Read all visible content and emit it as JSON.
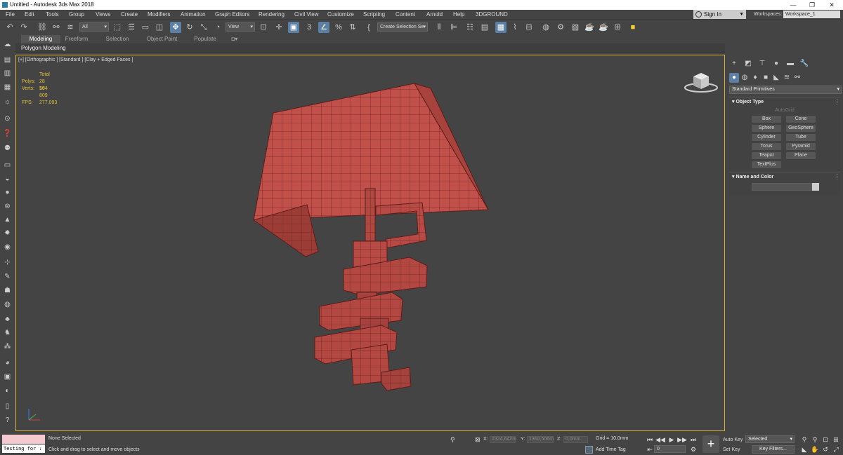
{
  "window": {
    "title": "Untitled - Autodesk 3ds Max 2018",
    "min": "—",
    "restore": "❐",
    "close": "✕"
  },
  "menu": [
    "File",
    "Edit",
    "Tools",
    "Group",
    "Views",
    "Create",
    "Modifiers",
    "Animation",
    "Graph Editors",
    "Rendering",
    "Civil View",
    "Customize",
    "Scripting",
    "Content",
    "Arnold",
    "Help",
    "3DGROUND"
  ],
  "account": {
    "sign_in": "Sign In",
    "workspaces_label": "Workspaces:",
    "workspace": "Workspace_1"
  },
  "toolbar": {
    "selection_filter": "All",
    "ref_coord": "View",
    "named_selection": "Create Selection Se"
  },
  "ribbon": {
    "tabs": [
      "Modeling",
      "Freeform",
      "Selection",
      "Object Paint",
      "Populate"
    ],
    "active": "Modeling",
    "subtitle": "Polygon Modeling"
  },
  "viewport": {
    "label": "[+] [Orthographic ] [Standard ] [Clay + Edged Faces ]",
    "stats": {
      "header": "Total",
      "polys_label": "Polys:",
      "polys": "28 594",
      "verts_label": "Verts:",
      "verts": "16 809",
      "fps_label": "FPS:",
      "fps": "277,093"
    },
    "mesh_color": "#c0504a",
    "highlight_color": "#d8b23a"
  },
  "command_panel": {
    "category": "Standard Primitives",
    "object_type": {
      "title": "Object Type",
      "autogrid": "AutoGrid",
      "buttons": [
        "Box",
        "Cone",
        "Sphere",
        "GeoSphere",
        "Cylinder",
        "Tube",
        "Torus",
        "Pyramid",
        "Teapot",
        "Plane",
        "TextPlus"
      ]
    },
    "name_color": {
      "title": "Name and Color"
    }
  },
  "status": {
    "selection": "None Selected",
    "prompt": "Click and drag to select and move objects",
    "maxscript": "Testing for :",
    "x_label": "X:",
    "x": "2324,642m",
    "y_label": "Y:",
    "y": "1360,506m",
    "z_label": "Z:",
    "z": "0,0mm",
    "grid": "Grid = 10,0mm",
    "add_time_tag": "Add Time Tag",
    "frame": "0",
    "auto_key": "Auto Key",
    "set_key": "Set Key",
    "key_mode": "Selected",
    "key_filters": "Key Filters..."
  }
}
